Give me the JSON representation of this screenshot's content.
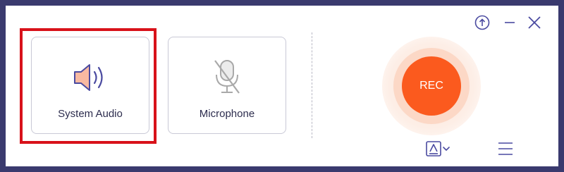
{
  "window": {
    "controls": {
      "upgrade_icon": "upload-circle-icon",
      "minimize_icon": "minimize-icon",
      "close_icon": "close-icon"
    }
  },
  "sources": {
    "system_audio": {
      "label": "System Audio",
      "icon": "speaker-icon",
      "selected": true
    },
    "microphone": {
      "label": "Microphone",
      "icon": "microphone-muted-icon",
      "selected": false
    }
  },
  "record": {
    "label": "REC"
  },
  "bottom_bar": {
    "format_icon": "format-select-icon",
    "menu_icon": "hamburger-menu-icon"
  },
  "colors": {
    "accent": "#fb5a1e",
    "icon": "#4a4aa0",
    "highlight": "#d8121a",
    "frame": "#3a3a6e"
  }
}
